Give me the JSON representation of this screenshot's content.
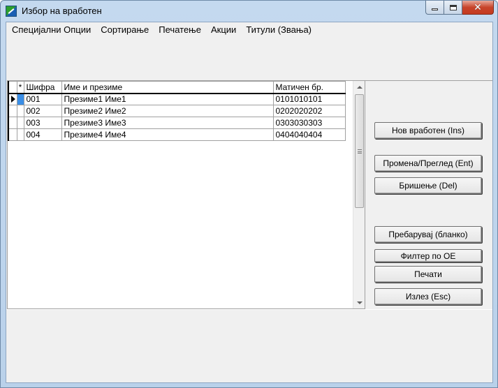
{
  "window": {
    "title": "Избор на вработен",
    "caption": {
      "minimize": "",
      "maximize": "",
      "close": "✕"
    }
  },
  "menu": [
    "Специјални Опции",
    "Сортирање",
    "Печатење",
    "Акции",
    "Титули (Звања)"
  ],
  "grid": {
    "columns": {
      "star": "*",
      "code": "Шифра",
      "name": "Име и презиме",
      "embg": "Матичен бр."
    },
    "rows": [
      {
        "code": "001",
        "name": "Презиме1 Име1",
        "embg": "0101010101"
      },
      {
        "code": "002",
        "name": "Презиме2 Име2",
        "embg": "0202020202"
      },
      {
        "code": "003",
        "name": "Презиме3 Име3",
        "embg": "0303030303"
      },
      {
        "code": "004",
        "name": "Презиме4 Име4",
        "embg": "0404040404"
      }
    ]
  },
  "buttons": {
    "new": "Нов вработен (Ins)",
    "edit": "Промена/Преглед (Ent)",
    "delete": "Бришење (Del)",
    "search": "Пребарувај (бланко)",
    "filter": "Филтер по ОЕ",
    "print": "Печати",
    "exit": "Излез (Esc)"
  },
  "icons": {
    "app": "app-logo-icon",
    "pointer": "row-pointer-icon"
  }
}
